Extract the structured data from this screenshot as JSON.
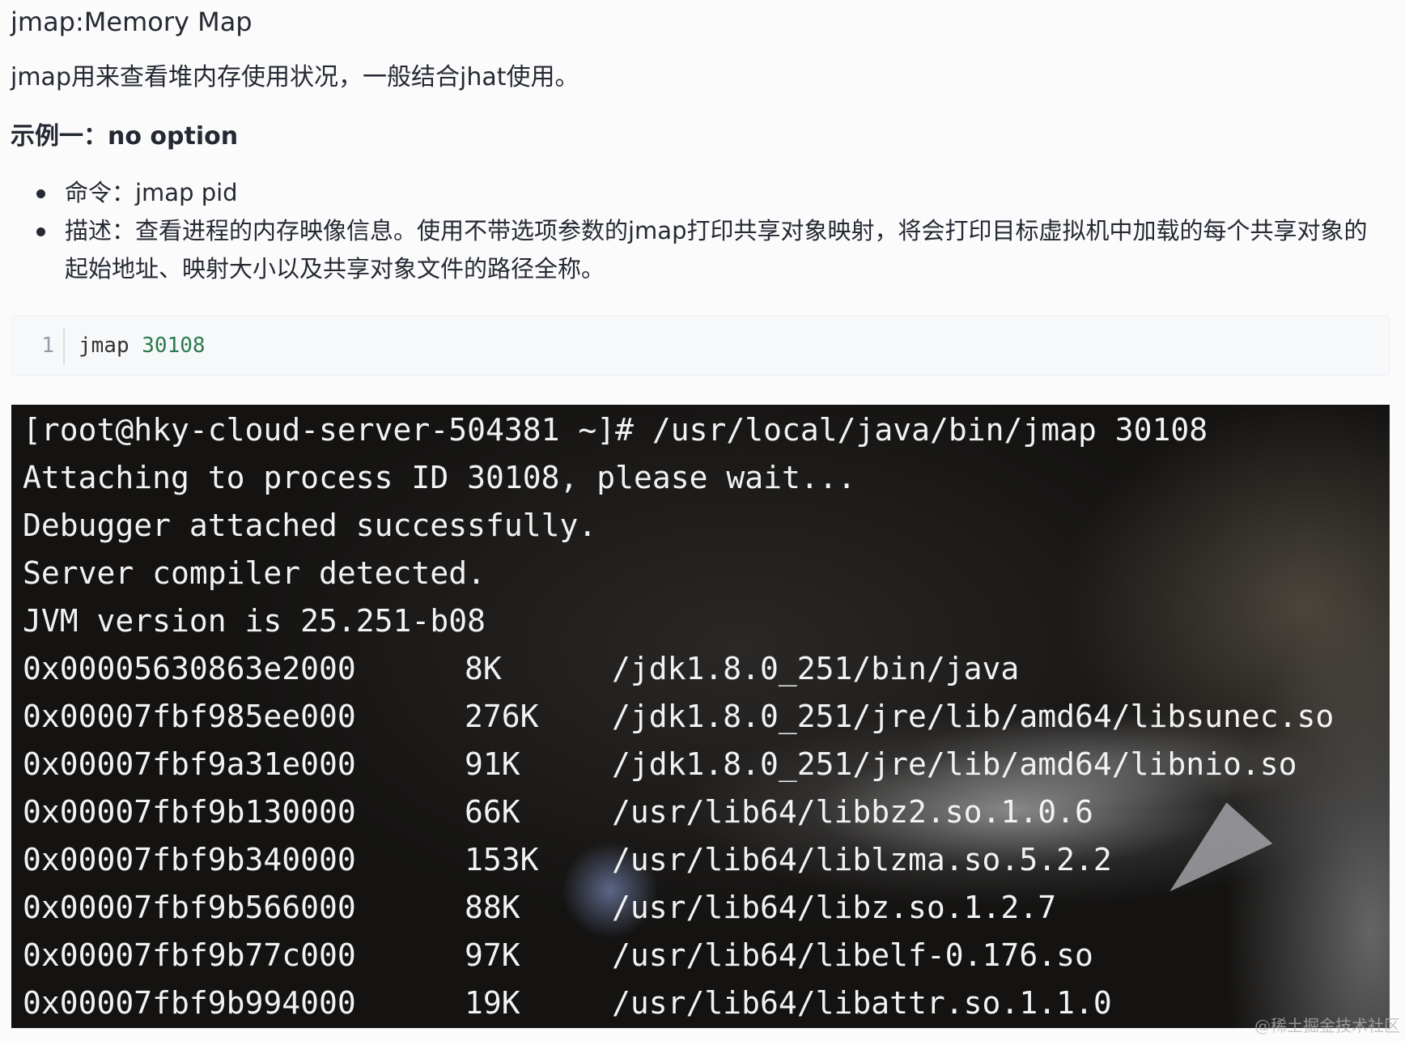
{
  "heading": "jmap:Memory Map",
  "intro": "jmap用来查看堆内存使用状况，一般结合jhat使用。",
  "example_title": "示例一：no option",
  "bullets": [
    "命令：jmap pid",
    "描述：查看进程的内存映像信息。使用不带选项参数的jmap打印共享对象映射，将会打印目标虚拟机中加载的每个共享对象的起始地址、映射大小以及共享对象文件的路径全称。"
  ],
  "code_block": {
    "line_number": "1",
    "command": "jmap",
    "argument": "30108"
  },
  "terminal": {
    "lines": [
      "[root@hky-cloud-server-504381 ~]# /usr/local/java/bin/jmap 30108",
      "Attaching to process ID 30108, please wait...",
      "Debugger attached successfully.",
      "Server compiler detected.",
      "JVM version is 25.251-b08"
    ],
    "mappings": [
      {
        "address": "0x00005630863e2000",
        "size": "8K",
        "path": "/jdk1.8.0_251/bin/java"
      },
      {
        "address": "0x00007fbf985ee000",
        "size": "276K",
        "path": "/jdk1.8.0_251/jre/lib/amd64/libsunec.so"
      },
      {
        "address": "0x00007fbf9a31e000",
        "size": "91K",
        "path": "/jdk1.8.0_251/jre/lib/amd64/libnio.so"
      },
      {
        "address": "0x00007fbf9b130000",
        "size": "66K",
        "path": "/usr/lib64/libbz2.so.1.0.6"
      },
      {
        "address": "0x00007fbf9b340000",
        "size": "153K",
        "path": "/usr/lib64/liblzma.so.5.2.2"
      },
      {
        "address": "0x00007fbf9b566000",
        "size": "88K",
        "path": "/usr/lib64/libz.so.1.2.7"
      },
      {
        "address": "0x00007fbf9b77c000",
        "size": "97K",
        "path": "/usr/lib64/libelf-0.176.so"
      },
      {
        "address": "0x00007fbf9b994000",
        "size": "19K",
        "path": "/usr/lib64/libattr.so.1.1.0"
      }
    ]
  },
  "watermark": "@稀土掘金技术社区"
}
